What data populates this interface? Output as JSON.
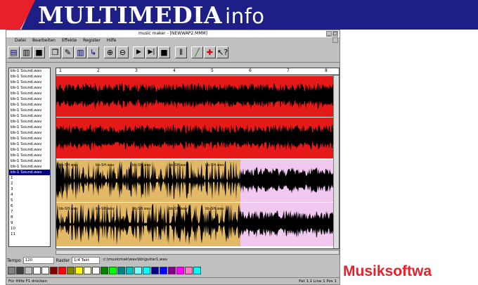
{
  "banner": {
    "title_main": "MULTIMEDIA",
    "title_sub": "info"
  },
  "window": {
    "title": "music maker - [NEWWAP2.MMM]",
    "menu": [
      "Datei",
      "Bearbeiten",
      "Effekte",
      "Register",
      "Hilfe"
    ]
  },
  "toolbar": {
    "icons": [
      "arrange-icon",
      "save-icon",
      "floppy-icon",
      "copy-icon",
      "pencil-icon",
      "piano-icon",
      "split-icon",
      "zoom-in-icon",
      "zoom-out-icon",
      "play-icon",
      "play-from-icon",
      "stop-icon",
      "grid-icon",
      "draw-icon",
      "cross-icon",
      "help-pointer-icon"
    ]
  },
  "tracklist": {
    "items": [
      "bb-1 Sound.wav",
      "bb-1 Sound.wav",
      "bb-1 Sound.wav",
      "bb-1 Sound.wav",
      "bb-1 Sound.wav",
      "bb-1 Sound.wav",
      "bb-1 Sound.wav",
      "bb-1 Sound.wav",
      "bb-1 Sound.wav",
      "bb-1 Sound.wav",
      "bb-1 Sound.wav",
      "bb-1 Sound.wav",
      "bb-1 Sound.wav",
      "bb-1 Sound.wav",
      "bb-1 Sound.wav",
      "bb-1 Sound.wav",
      "bb-1 Sound.wav",
      "bb-1 Sound.wav",
      "bb-1 Sound.wav",
      "1",
      "2",
      "3",
      "4",
      "5",
      "6",
      "7",
      "8",
      "9",
      "10",
      "11"
    ],
    "selected_index": 18
  },
  "ruler": [
    "1",
    "2",
    "3",
    "4",
    "5",
    "6",
    "7",
    "8"
  ],
  "lanes": [
    {
      "color": "red",
      "labels": []
    },
    {
      "color": "red",
      "labels": []
    },
    {
      "color": "orange",
      "labels": [
        "bb-SH.wav",
        "bb-SH.wav",
        "bb-SH.wav",
        "bb-SH.wav",
        "bb-SH.wav"
      ]
    },
    {
      "color": "orange",
      "labels": [
        "bb-SH.wav",
        "bb-SH.wav",
        "bb-SH.wav",
        "bb-SH.wav",
        "bb-SH.wav"
      ]
    }
  ],
  "statusrow": {
    "tempo_label": "Tempo",
    "tempo_value": "120",
    "raster_label": "Raster",
    "raster_value": "1/4 Takt",
    "path": "c:\\musicmak\\wav\\bb\\guitar1.wav"
  },
  "palette": [
    "#808080",
    "#404040",
    "#c0c0c0",
    "#ffffff",
    "#ffffff",
    "#800000",
    "#ff0000",
    "#808000",
    "#ffff00",
    "#ffffe0",
    "#ffffff",
    "#008000",
    "#00ff00",
    "#008080",
    "#00c0c0",
    "#80ffff",
    "#00ffff",
    "#000080",
    "#0000ff",
    "#800080",
    "#ff00ff",
    "#ff80c0",
    "#00ffff"
  ],
  "bottomstatus": {
    "left": "Für Hilfe F1 drücken",
    "right": "Pat 1.1 Line 1 Pos 1"
  },
  "caption": "Musiksoftwa"
}
